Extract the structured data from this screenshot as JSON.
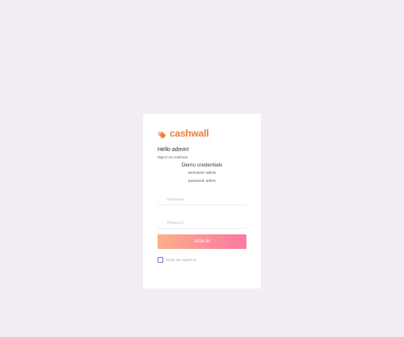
{
  "brand": {
    "name": "cashwall",
    "accent_color": "#f07a3c",
    "icon": "tag-icon"
  },
  "login": {
    "greeting": "Hello admin!",
    "subtitle": "Sign in to continue.",
    "demo_title": "Demo credentials",
    "demo_username": "username: admin",
    "demo_password": "password: admin",
    "username_placeholder": "Username",
    "password_placeholder": "Password",
    "signin_label": "SIGN IN",
    "remember_label": "Keep me signed in",
    "button_gradient": [
      "#fcb08a",
      "#fb7a9e"
    ]
  },
  "colors": {
    "background": "#f2edf2",
    "card": "#ffffff",
    "checkbox": "#7b6ed6"
  }
}
